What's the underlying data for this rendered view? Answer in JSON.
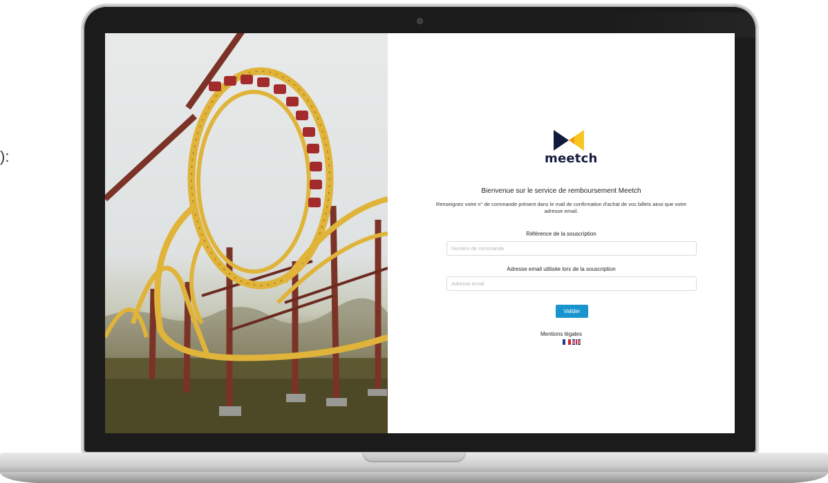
{
  "outside": {
    "partial_text": "):"
  },
  "page": {
    "brand": "meetch",
    "title": "Bienvenue sur le service de remboursement Meetch",
    "description": "Renseignez votre n° de commande présent dans le mail de confirmation d'achat de vos billets ainsi que votre adresse email.",
    "reference": {
      "label": "Référence de la souscription",
      "placeholder": "Numéro de commande"
    },
    "email": {
      "label": "Adresse email utilisée lors de la souscription",
      "placeholder": "Adresse email"
    },
    "submit_label": "Valider",
    "legal_label": "Mentions légales",
    "languages": [
      "fr-flag-icon",
      "uk-flag-icon"
    ]
  },
  "colors": {
    "button": "#1a94cf",
    "logo_navy": "#141a3c",
    "logo_yellow": "#f7c51d",
    "coaster_track": "#e0b43a",
    "coaster_supports": "#7b3327"
  },
  "icons": {
    "logo": "meetch-bowtie-logo"
  }
}
